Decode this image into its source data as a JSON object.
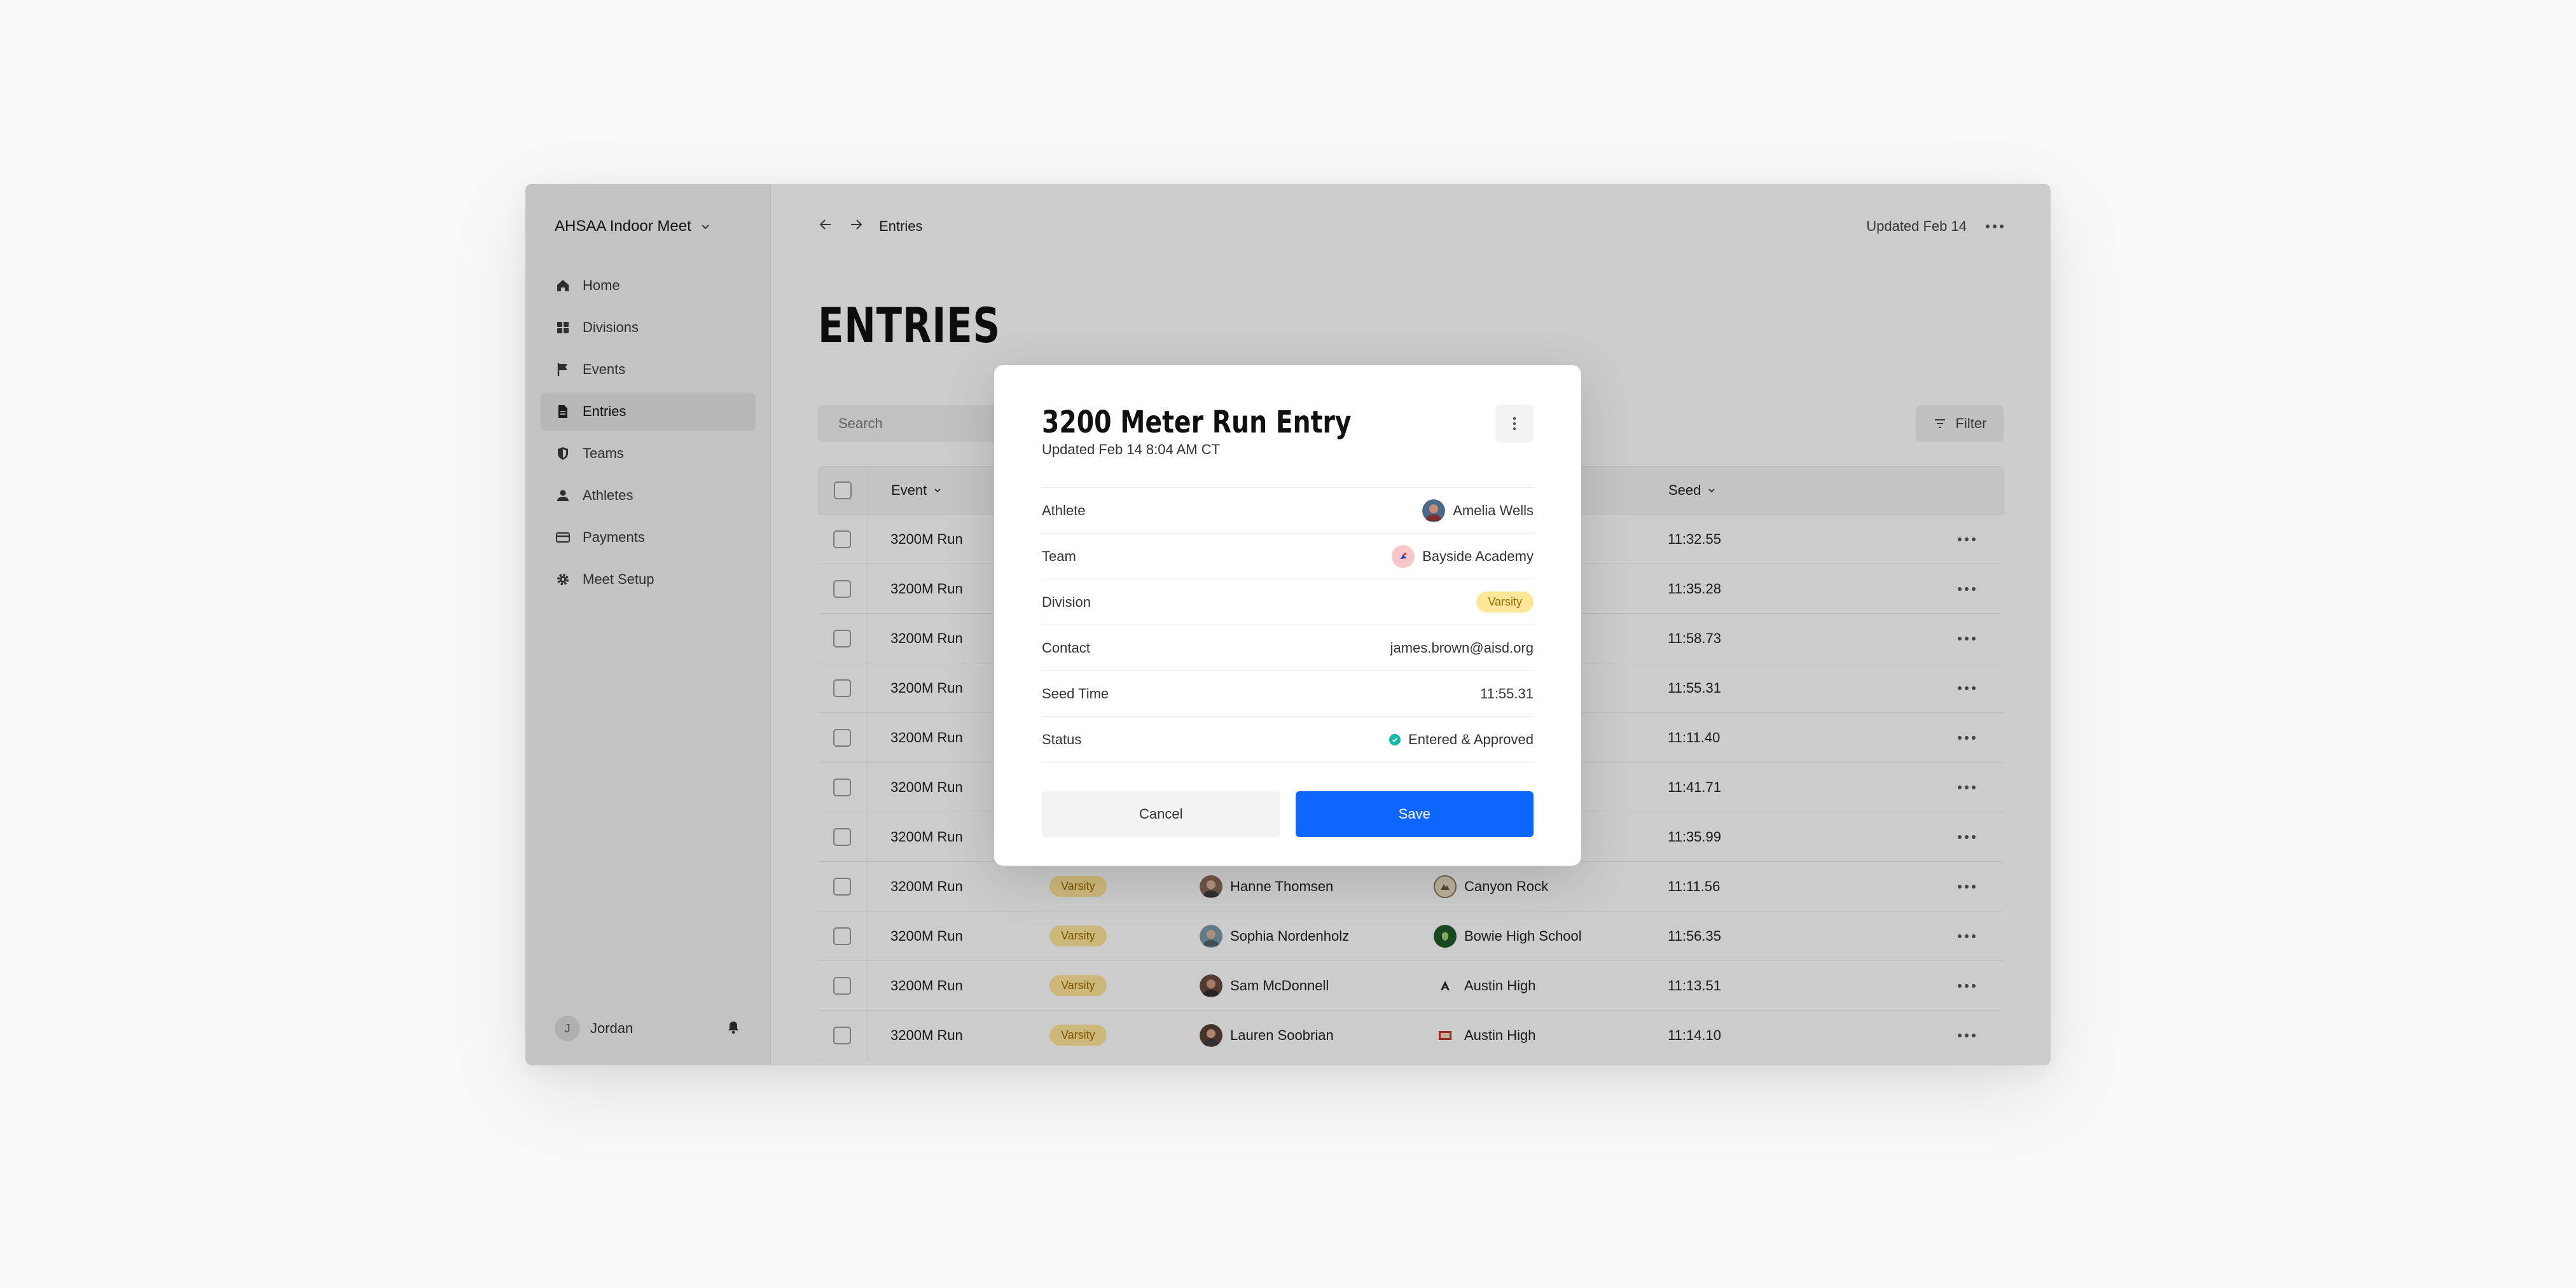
{
  "sidebar": {
    "meet_name": "AHSAA Indoor Meet",
    "nav": [
      {
        "label": "Home",
        "icon": "home-icon"
      },
      {
        "label": "Divisions",
        "icon": "grid-icon"
      },
      {
        "label": "Events",
        "icon": "flag-icon"
      },
      {
        "label": "Entries",
        "icon": "document-icon",
        "active": true
      },
      {
        "label": "Teams",
        "icon": "shield-icon"
      },
      {
        "label": "Athletes",
        "icon": "person-icon"
      },
      {
        "label": "Payments",
        "icon": "card-icon"
      },
      {
        "label": "Meet Setup",
        "icon": "gear-icon"
      }
    ],
    "user": {
      "initial": "J",
      "name": "Jordan"
    }
  },
  "topbar": {
    "breadcrumb": "Entries",
    "updated": "Updated Feb 14"
  },
  "page": {
    "title": "ENTRIES",
    "search_placeholder": "Search",
    "filter_label": "Filter"
  },
  "table": {
    "headers": {
      "event": "Event",
      "seed": "Seed"
    },
    "rows": [
      {
        "event": "3200M Run",
        "division": "",
        "athlete": "",
        "team": "",
        "seed": "11:32.55"
      },
      {
        "event": "3200M Run",
        "division": "",
        "athlete": "",
        "team": "",
        "seed": "11:35.28"
      },
      {
        "event": "3200M Run",
        "division": "",
        "athlete": "",
        "team": "",
        "seed": "11:58.73"
      },
      {
        "event": "3200M Run",
        "division": "",
        "athlete": "",
        "team": "",
        "seed": "11:55.31"
      },
      {
        "event": "3200M Run",
        "division": "",
        "athlete": "",
        "team": "",
        "seed": "11:11.40"
      },
      {
        "event": "3200M Run",
        "division": "",
        "athlete": "",
        "team": "",
        "seed": "11:41.71"
      },
      {
        "event": "3200M Run",
        "division": "",
        "athlete": "",
        "team": "",
        "seed": "11:35.99"
      },
      {
        "event": "3200M Run",
        "division": "Varsity",
        "athlete": "Hanne Thomsen",
        "team": "Canyon Rock",
        "seed": "11:11.56"
      },
      {
        "event": "3200M Run",
        "division": "Varsity",
        "athlete": "Sophia Nordenholz",
        "team": "Bowie High School",
        "seed": "11:56.35"
      },
      {
        "event": "3200M Run",
        "division": "Varsity",
        "athlete": "Sam McDonnell",
        "team": "Austin High",
        "seed": "11:13.51"
      },
      {
        "event": "3200M Run",
        "division": "Varsity",
        "athlete": "Lauren Soobrian",
        "team": "Austin High",
        "seed": "11:14.10"
      }
    ]
  },
  "modal": {
    "title": "3200 Meter Run Entry",
    "subtitle": "Updated Feb 14 8:04 AM CT",
    "fields": [
      {
        "label": "Athlete",
        "value": "Amelia Wells"
      },
      {
        "label": "Team",
        "value": "Bayside Academy"
      },
      {
        "label": "Division",
        "value": "Varsity"
      },
      {
        "label": "Contact",
        "value": "james.brown@aisd.org"
      },
      {
        "label": "Seed Time",
        "value": "11:55.31"
      },
      {
        "label": "Status",
        "value": "Entered & Approved"
      }
    ],
    "cancel_label": "Cancel",
    "save_label": "Save"
  },
  "colors": {
    "accent": "#0d66ff",
    "badge_bg": "#ffe79a",
    "badge_text": "#9a6b00",
    "status_ok": "#14b8a6"
  }
}
